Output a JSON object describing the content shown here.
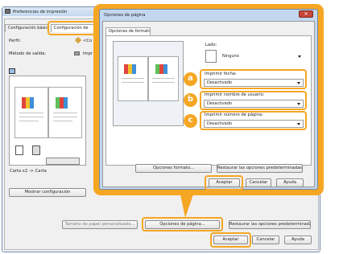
{
  "main_window": {
    "title": "Preferencias de impresión",
    "tabs": [
      "Configuración básica",
      "Configuración de"
    ],
    "perfil_label": "Perfil:",
    "perfil_value": "<Co",
    "metodo_label": "Método de salida:",
    "metodo_value": "Impr",
    "preview_caption": "Carta x2 -> Carta",
    "mostrar_button": "Mostrar configuración",
    "tamano_button": "Tamaño de papel personalizado...",
    "opciones_pagina_button": "Opciones de página...",
    "restaurar_button": "Restaurar las opciones predeterminadas",
    "aceptar": "Aceptar",
    "cancelar": "Cancelar",
    "ayuda": "Ayuda"
  },
  "dialog": {
    "title": "Opciones de página",
    "tab": "Opciones de formato",
    "lado_label": "Lado:",
    "lado_value": "Ninguno",
    "fields": [
      {
        "badge": "a",
        "label": "Imprimir fecha:",
        "value": "Desactivado"
      },
      {
        "badge": "b",
        "label": "Imprimir nombre de usuario:",
        "value": "Desactivado"
      },
      {
        "badge": "c",
        "label": "Imprimir número de página:",
        "value": "Desactivado"
      }
    ],
    "opciones_formato_button": "Opciones formato...",
    "restaurar_button": "Restaurar las opciones predeterminadas",
    "aceptar": "Aceptar",
    "cancelar": "Cancelar",
    "ayuda": "Ayuda"
  },
  "colors": {
    "accent": "#f5a623",
    "dialog_frame": "#bfd4ec",
    "close": "#c9473b"
  }
}
